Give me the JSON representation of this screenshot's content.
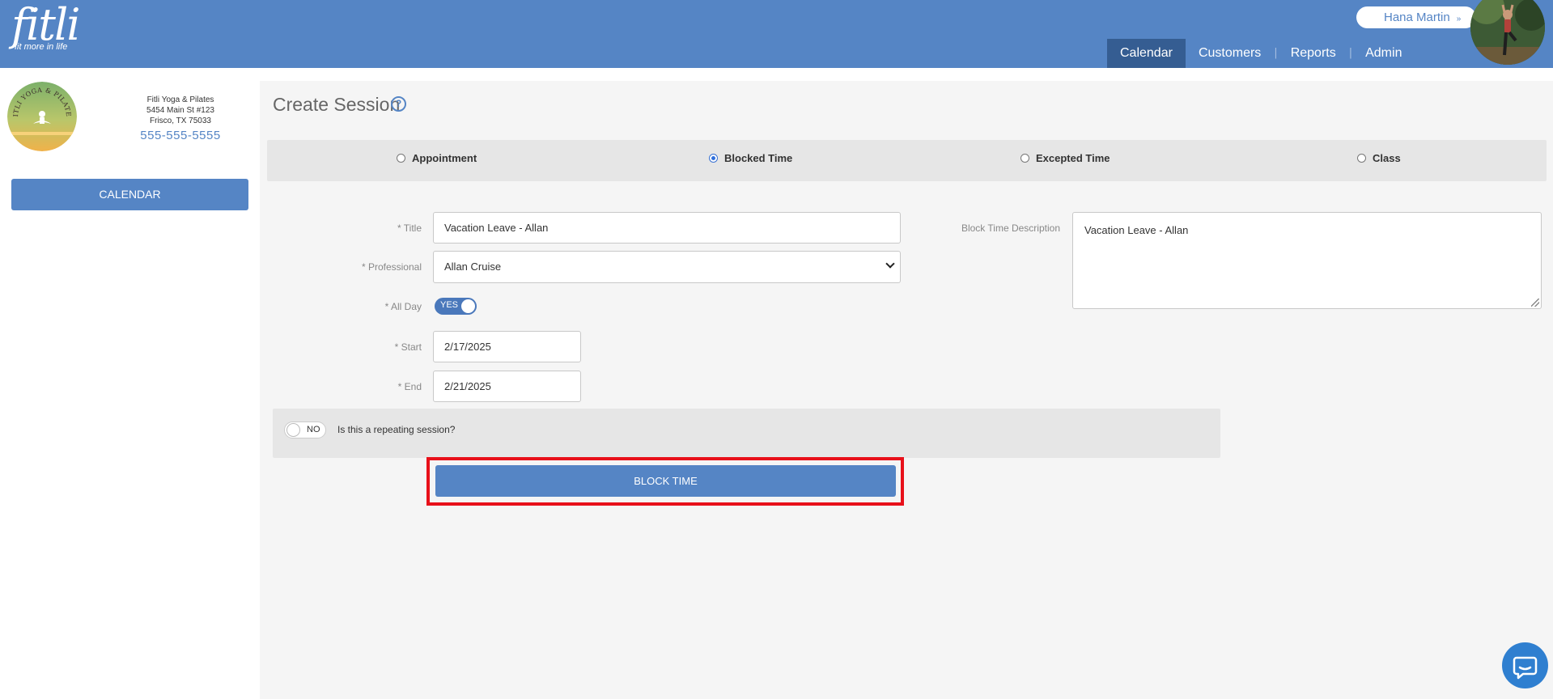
{
  "header": {
    "logo_text": "fitli",
    "logo_tagline": "fit more in life",
    "user_name": "Hana Martin",
    "user_chevron": "»",
    "nav": [
      {
        "label": "Calendar",
        "active": true
      },
      {
        "label": "Customers"
      },
      {
        "label": "Reports"
      },
      {
        "label": "Admin"
      }
    ],
    "nav_separator": "|"
  },
  "sidebar": {
    "studio_logo_text": "FITLI YOGA & PILATES",
    "studio_name": "Fitli Yoga & Pilates",
    "address_line1": "5454 Main St #123",
    "address_line2": "Frisco, TX 75033",
    "phone": "555-555-5555",
    "calendar_button": "CALENDAR"
  },
  "main": {
    "title": "Create Session",
    "help_icon_glyph": "?",
    "session_types": [
      {
        "label": "Appointment",
        "checked": false
      },
      {
        "label": "Blocked Time",
        "checked": true
      },
      {
        "label": "Excepted Time",
        "checked": false
      },
      {
        "label": "Class",
        "checked": false
      }
    ],
    "form": {
      "title_label": "* Title",
      "title_value": "Vacation Leave - Allan",
      "professional_label": "* Professional",
      "professional_value": "Allan Cruise",
      "allday_label": "* All Day",
      "allday_toggle": "YES",
      "start_label": "* Start",
      "start_value": "2/17/2025",
      "end_label": "* End",
      "end_value": "2/21/2025",
      "description_label": "Block Time Description",
      "description_value": "Vacation Leave - Allan"
    },
    "repeat": {
      "toggle": "NO",
      "question": "Is this a repeating session?"
    },
    "submit_button": "BLOCK TIME"
  },
  "colors": {
    "brand_blue": "#5585c5",
    "nav_active": "#355d92",
    "highlight_red": "#e8101a",
    "panel_bg": "#f5f5f5"
  },
  "icons": {
    "help": "help-circle-icon",
    "chat": "chat-bubble-icon",
    "select_chevron": "chevron-down-icon"
  }
}
